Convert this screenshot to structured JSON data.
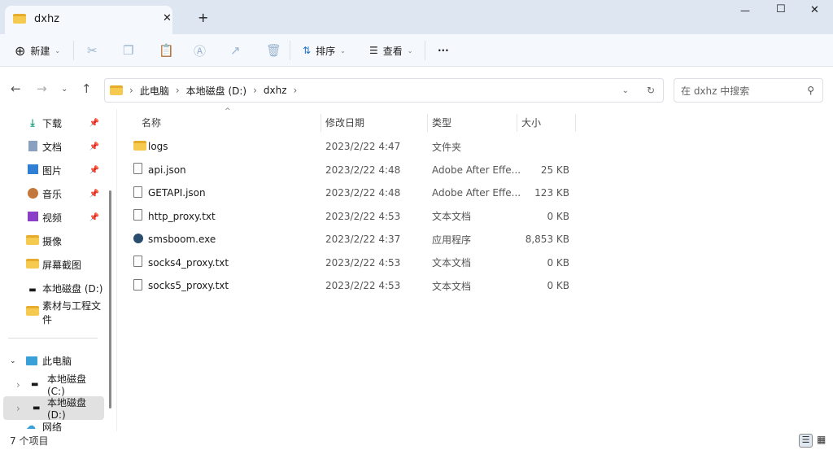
{
  "window": {
    "tab_title": "dxhz",
    "new_tab": "+",
    "min": "—",
    "max": "☐",
    "close": "✕"
  },
  "toolbar": {
    "new_label": "新建",
    "sort_label": "排序",
    "view_label": "查看",
    "more": "···"
  },
  "address": {
    "crumbs": [
      "此电脑",
      "本地磁盘 (D:)",
      "dxhz"
    ],
    "search_placeholder": "在 dxhz 中搜索"
  },
  "sidebar": {
    "quick": [
      {
        "label": "下载",
        "icon": "download-icon",
        "pinned": true
      },
      {
        "label": "文档",
        "icon": "document-icon",
        "pinned": true
      },
      {
        "label": "图片",
        "icon": "pictures-icon",
        "pinned": true
      },
      {
        "label": "音乐",
        "icon": "music-icon",
        "pinned": true
      },
      {
        "label": "视频",
        "icon": "video-icon",
        "pinned": true
      },
      {
        "label": "摄像",
        "icon": "folder-icon"
      },
      {
        "label": "屏幕截图",
        "icon": "folder-icon"
      },
      {
        "label": "本地磁盘 (D:)",
        "icon": "drive-icon"
      },
      {
        "label": "素材与工程文件",
        "icon": "folder-icon"
      }
    ],
    "this_pc": "此电脑",
    "drives": [
      "本地磁盘 (C:)",
      "本地磁盘 (D:)"
    ],
    "network": "网络"
  },
  "columns": {
    "name": "名称",
    "date": "修改日期",
    "type": "类型",
    "size": "大小"
  },
  "files": [
    {
      "name": "logs",
      "date": "2023/2/22 4:47",
      "type": "文件夹",
      "size": "",
      "icon": "folder-icon"
    },
    {
      "name": "api.json",
      "date": "2023/2/22 4:48",
      "type": "Adobe After Effe...",
      "size": "25 KB",
      "icon": "file-icon"
    },
    {
      "name": "GETAPI.json",
      "date": "2023/2/22 4:48",
      "type": "Adobe After Effe...",
      "size": "123 KB",
      "icon": "file-icon"
    },
    {
      "name": "http_proxy.txt",
      "date": "2023/2/22 4:53",
      "type": "文本文档",
      "size": "0 KB",
      "icon": "file-icon"
    },
    {
      "name": "smsboom.exe",
      "date": "2023/2/22 4:37",
      "type": "应用程序",
      "size": "8,853 KB",
      "icon": "exe-icon"
    },
    {
      "name": "socks4_proxy.txt",
      "date": "2023/2/22 4:53",
      "type": "文本文档",
      "size": "0 KB",
      "icon": "file-icon"
    },
    {
      "name": "socks5_proxy.txt",
      "date": "2023/2/22 4:53",
      "type": "文本文档",
      "size": "0 KB",
      "icon": "file-icon"
    }
  ],
  "status": {
    "count": "7 个项目"
  }
}
